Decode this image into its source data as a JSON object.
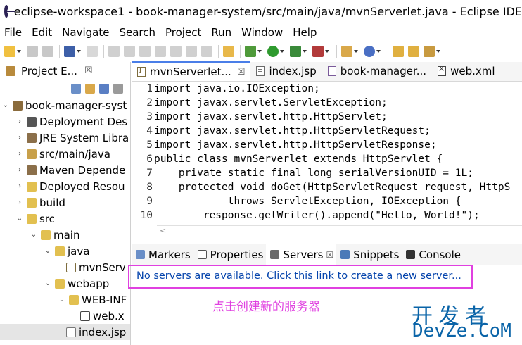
{
  "window": {
    "title": "eclipse-workspace1 - book-manager-system/src/main/java/mvnServerlet.java - Eclipse IDE"
  },
  "menu": [
    "File",
    "Edit",
    "Navigate",
    "Search",
    "Project",
    "Run",
    "Window",
    "Help"
  ],
  "project_explorer": {
    "tab_label": "Project E...",
    "close": "☒",
    "items": [
      {
        "label": "book-manager-syst",
        "arrow": "⌄",
        "icon": "project-icon"
      },
      {
        "label": "Deployment Des",
        "arrow": "›",
        "icon": "deployment-icon"
      },
      {
        "label": "JRE System Libra",
        "arrow": "›",
        "icon": "library-icon"
      },
      {
        "label": "src/main/java",
        "arrow": "›",
        "icon": "source-folder-icon"
      },
      {
        "label": "Maven Depende",
        "arrow": "›",
        "icon": "library-icon"
      },
      {
        "label": "Deployed Resou",
        "arrow": "›",
        "icon": "folder-icon"
      },
      {
        "label": "build",
        "arrow": "›",
        "icon": "folder-icon"
      },
      {
        "label": "src",
        "arrow": "⌄",
        "icon": "folder-icon"
      },
      {
        "label": "main",
        "arrow": "⌄",
        "icon": "folder-icon"
      },
      {
        "label": "java",
        "arrow": "⌄",
        "icon": "folder-icon"
      },
      {
        "label": "mvnServ",
        "arrow": "",
        "icon": "java-file-icon"
      },
      {
        "label": "webapp",
        "arrow": "⌄",
        "icon": "folder-icon"
      },
      {
        "label": "WEB-INF",
        "arrow": "⌄",
        "icon": "folder-icon"
      },
      {
        "label": "web.x",
        "arrow": "",
        "icon": "xml-file-icon"
      },
      {
        "label": "index.jsp",
        "arrow": "",
        "icon": "jsp-file-icon"
      }
    ]
  },
  "editor": {
    "tabs": [
      {
        "label": "mvnServerlet...",
        "close": "☒",
        "active": true
      },
      {
        "label": "index.jsp",
        "close": "",
        "active": false
      },
      {
        "label": "book-manager...",
        "close": "",
        "active": false
      },
      {
        "label": "web.xml",
        "close": "",
        "active": false
      }
    ],
    "lines": [
      {
        "n": "1",
        "text": "import java.io.IOException;"
      },
      {
        "n": "2",
        "text": "import javax.servlet.ServletException;"
      },
      {
        "n": "3",
        "text": "import javax.servlet.http.HttpServlet;"
      },
      {
        "n": "4",
        "text": "import javax.servlet.http.HttpServletRequest;"
      },
      {
        "n": "5",
        "text": "import javax.servlet.http.HttpServletResponse;"
      },
      {
        "n": "6",
        "text": "public class mvnServerlet extends HttpServlet {"
      },
      {
        "n": "7",
        "text": "    private static final long serialVersionUID = 1L;"
      },
      {
        "n": "8",
        "text": "    protected void doGet(HttpServletRequest request, HttpS"
      },
      {
        "n": "9",
        "text": "            throws ServletException, IOException {"
      },
      {
        "n": "10",
        "text": "        response.getWriter().append(\"Hello, World!\");"
      }
    ]
  },
  "bottom_panel": {
    "tabs": [
      {
        "label": "Markers",
        "close": "",
        "active": false
      },
      {
        "label": "Properties",
        "close": "",
        "active": false
      },
      {
        "label": "Servers",
        "close": "☒",
        "active": true
      },
      {
        "label": "Snippets",
        "close": "",
        "active": false
      },
      {
        "label": "Console",
        "close": "",
        "active": false
      }
    ],
    "servers_link": "No servers are available. Click this link to create a new server..."
  },
  "annotation": "点击创建新的服务器",
  "watermark": {
    "cn": "开发者",
    "en": "DevZe.CoM"
  },
  "colors": {
    "highlight": "#e040e0",
    "link": "#0645ad",
    "watermark": "#0a64a8",
    "tab_active_border": "#4a7ee8"
  }
}
